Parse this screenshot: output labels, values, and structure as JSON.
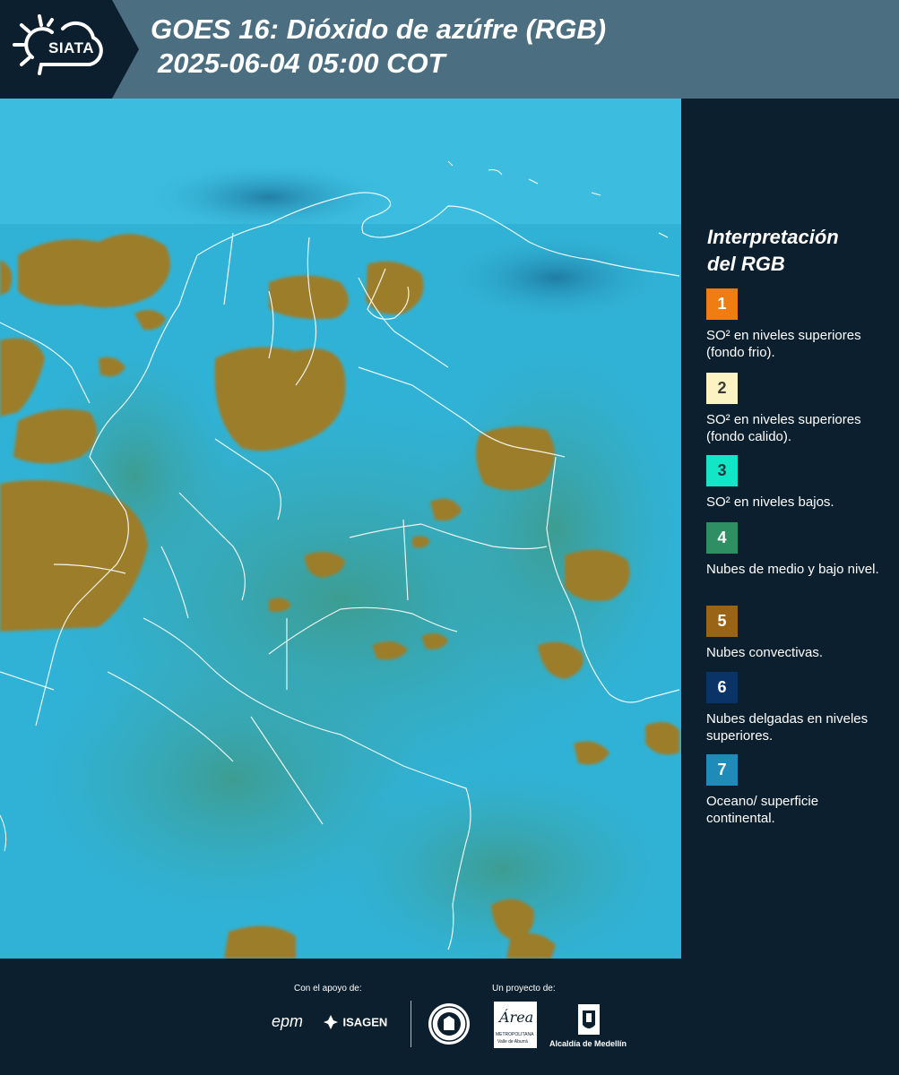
{
  "header": {
    "logo_text": "SIATA",
    "title_line1": "GOES 16: Dióxido de azúfre (RGB)",
    "title_line2": "2025-06-04 05:00 COT"
  },
  "map": {
    "description_icon": "satellite-rgb-map"
  },
  "legend": {
    "title_line1": "Interpretación",
    "title_line2": "del RGB",
    "items": [
      {
        "number": "1",
        "color": "#f07d14",
        "text": "SO² en niveles superiores (fondo frio).",
        "text_color": "#ffffff"
      },
      {
        "number": "2",
        "color": "#fbf3c2",
        "text": "SO² en niveles superiores (fondo calido).",
        "text_color": "#3a3a3a"
      },
      {
        "number": "3",
        "color": "#13e6c6",
        "text": "SO² en niveles bajos.",
        "text_color": "#1a3a3a"
      },
      {
        "number": "4",
        "color": "#2e8f62",
        "text": "Nubes de medio y bajo nivel.",
        "text_color": "#ffffff"
      },
      {
        "number": "5",
        "color": "#9a6416",
        "text": "Nubes convectivas.",
        "text_color": "#ffffff"
      },
      {
        "number": "6",
        "color": "#0a3468",
        "text": "Nubes delgadas en niveles superiores.",
        "text_color": "#ffffff"
      },
      {
        "number": "7",
        "color": "#1e8bb8",
        "text": "Oceano/ superficie continental.",
        "text_color": "#ffffff"
      }
    ]
  },
  "footer": {
    "support_label": "Con el apoyo de:",
    "project_label": "Un proyecto de:",
    "epm": "epm",
    "isagen": "ISAGEN",
    "area_name": "Área",
    "area_sub1": "METROPOLITANA",
    "area_sub2": "Valle de Aburrá",
    "alcaldia": "Alcaldía de Medellín"
  },
  "colors": {
    "background": "#0c1f2e",
    "header": "#4b6f80",
    "ocean": "#32b4d6",
    "convective": "#9a7a2a"
  }
}
